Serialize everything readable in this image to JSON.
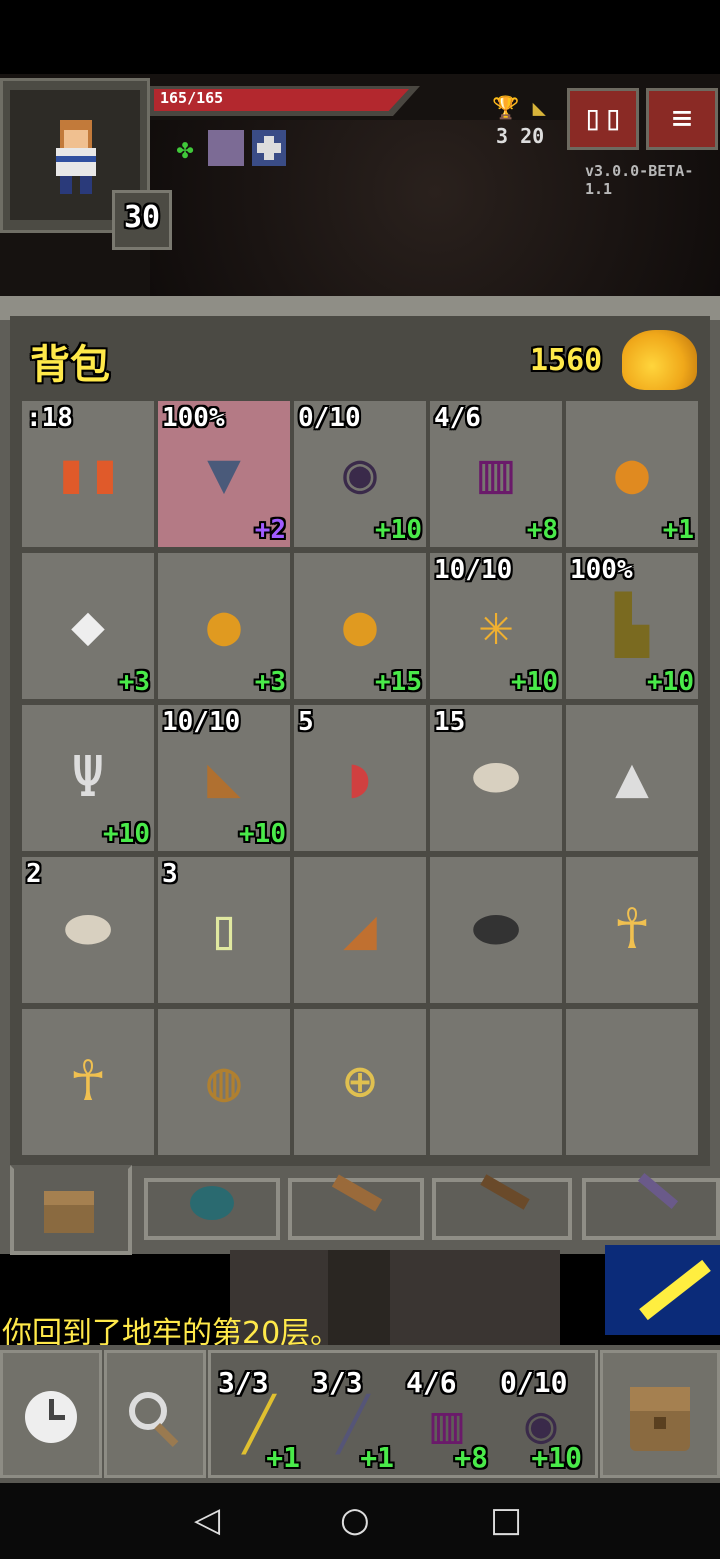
{
  "hud": {
    "hp_text": "165/165",
    "hp_fraction": 1.0,
    "level": "30",
    "stat_icons": "🏆  ◣",
    "stat_values": "3  20",
    "version": "v3.0.0-BETA-1.1",
    "journal_icon": "journal-icon",
    "menu_icon": "menu-icon"
  },
  "backpack": {
    "title": "背包",
    "gold": "1560",
    "rows": [
      [
        {
          "tl": ":18",
          "icon": "▮▮",
          "icon_name": "armor-icon",
          "br": "",
          "color": "#e05a2a"
        },
        {
          "tl": "100%",
          "icon": "▼",
          "icon_name": "anvil-icon",
          "br": "+2",
          "br_purple": true,
          "equipped": true,
          "color": "#4a5a7a"
        },
        {
          "tl": "0/10",
          "icon": "◉",
          "icon_name": "cloak-icon",
          "br": "+10",
          "color": "#3a2a4a"
        },
        {
          "tl": "4/6",
          "icon": "▥",
          "icon_name": "spellbook-icon",
          "br": "+8",
          "color": "#6a1a6a"
        },
        {
          "tl": "",
          "icon": "●",
          "icon_name": "ring-icon",
          "br": "+1",
          "color": "#e08a20"
        }
      ],
      [
        {
          "tl": "",
          "icon": "◆",
          "icon_name": "stone-icon",
          "br": "+3",
          "color": "#eeeeee"
        },
        {
          "tl": "",
          "icon": "●",
          "icon_name": "ring-icon",
          "br": "+3",
          "color": "#e09a20"
        },
        {
          "tl": "",
          "icon": "●",
          "icon_name": "ring-icon",
          "br": "+15",
          "color": "#e09a20"
        },
        {
          "tl": "10/10",
          "icon": "✳",
          "icon_name": "tome-icon",
          "br": "+10",
          "color": "#f0b030"
        },
        {
          "tl": "100%",
          "icon": "▙",
          "icon_name": "boots-icon",
          "br": "+10",
          "color": "#7a6a20"
        }
      ],
      [
        {
          "tl": "",
          "icon": "Ψ",
          "icon_name": "chalice-icon",
          "br": "+10",
          "color": "#dddddd"
        },
        {
          "tl": "10/10",
          "icon": "◣",
          "icon_name": "horn-icon",
          "br": "+10",
          "color": "#b07030"
        },
        {
          "tl": "5",
          "icon": "◗",
          "icon_name": "meat-icon",
          "br": "",
          "color": "#d04040"
        },
        {
          "tl": "15",
          "icon": "⬬",
          "icon_name": "bread-icon",
          "br": "",
          "color": "#d8d0c0"
        },
        {
          "tl": "",
          "icon": "▲",
          "icon_name": "seed-icon",
          "br": "",
          "color": "#dddddd"
        }
      ],
      [
        {
          "tl": "2",
          "icon": "⬬",
          "icon_name": "bread-icon",
          "br": "",
          "color": "#d8d0c0"
        },
        {
          "tl": "3",
          "icon": "▯",
          "icon_name": "potion-icon",
          "br": "",
          "color": "#e0e8a0"
        },
        {
          "tl": "",
          "icon": "◢",
          "icon_name": "pie-icon",
          "br": "",
          "color": "#c07030"
        },
        {
          "tl": "",
          "icon": "⬬",
          "icon_name": "bomb-icon",
          "br": "",
          "color": "#333333"
        },
        {
          "tl": "",
          "icon": "☥",
          "icon_name": "ankh-icon",
          "br": "",
          "color": "#f0c050"
        }
      ],
      [
        {
          "tl": "",
          "icon": "☥",
          "icon_name": "ankh-icon",
          "br": "",
          "color": "#f0c050"
        },
        {
          "tl": "",
          "icon": "◍",
          "icon_name": "pouch-icon",
          "br": "",
          "color": "#b08030"
        },
        {
          "tl": "",
          "icon": "⊕",
          "icon_name": "orb-icon",
          "br": "",
          "color": "#e0c050"
        },
        {
          "tl": "",
          "icon": "",
          "icon_name": "empty-slot",
          "br": "",
          "color": "#777670"
        },
        {
          "tl": "",
          "icon": "",
          "icon_name": "empty-slot",
          "br": "",
          "color": "#777670"
        }
      ]
    ]
  },
  "message": "你回到了地牢的第20层。",
  "quickslots": [
    {
      "tl": "3/3",
      "br": "+1",
      "icon": "╱",
      "icon_name": "wand-icon",
      "color": "#e0c030"
    },
    {
      "tl": "3/3",
      "br": "+1",
      "icon": "╱",
      "icon_name": "wand-icon",
      "color": "#555577"
    },
    {
      "tl": "4/6",
      "br": "+8",
      "icon": "▥",
      "icon_name": "spellbook-icon",
      "color": "#6a1a6a"
    },
    {
      "tl": "0/10",
      "br": "+10",
      "icon": "◉",
      "icon_name": "cloak-icon",
      "color": "#3a2a4a"
    }
  ],
  "toolbar": {
    "wait_icon": "🕒",
    "search_icon": "🔍",
    "backpack_icon": "🎒"
  },
  "nav": {
    "back": "◁",
    "home": "○",
    "recent": "□"
  }
}
